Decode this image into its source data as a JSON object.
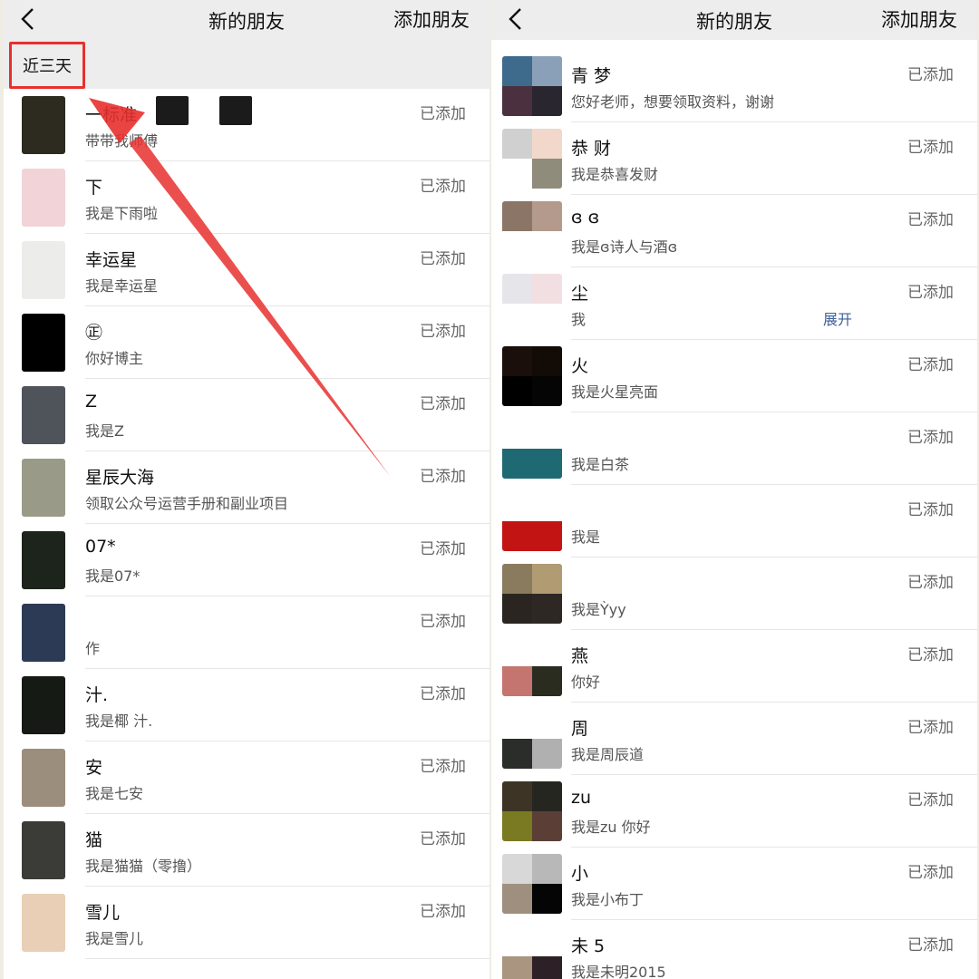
{
  "left": {
    "header": {
      "title": "新的朋友",
      "action": "添加朋友"
    },
    "section_label": "近三天",
    "rows": [
      {
        "name": "一标准",
        "msg": "带带我师傅",
        "status": "已添加"
      },
      {
        "name": "下",
        "msg": "我是下雨啦",
        "status": "已添加"
      },
      {
        "name": "幸运星",
        "msg": "我是幸运星",
        "status": "已添加"
      },
      {
        "name": "㊣",
        "msg": "你好博主",
        "status": "已添加"
      },
      {
        "name": "Z",
        "msg": "我是Z",
        "status": "已添加"
      },
      {
        "name": "星辰大海",
        "msg": "领取公众号运营手册和副业项目",
        "status": "已添加"
      },
      {
        "name": "07*",
        "msg": "我是07*",
        "status": "已添加"
      },
      {
        "name": "",
        "msg": "作",
        "status": "已添加"
      },
      {
        "name": "汁.",
        "msg": "我是椰 汁.",
        "status": "已添加"
      },
      {
        "name": "安",
        "msg": "我是七安",
        "status": "已添加"
      },
      {
        "name": "猫",
        "msg": "我是猫猫（零撸）",
        "status": "已添加"
      },
      {
        "name": "雪儿",
        "msg": "我是雪儿",
        "status": "已添加"
      }
    ]
  },
  "right": {
    "header": {
      "title": "新的朋友",
      "action": "添加朋友"
    },
    "expand_label": "展开",
    "rows": [
      {
        "name": "青 梦",
        "msg": "您好老师，想要领取资料，谢谢",
        "status": "已添加"
      },
      {
        "name": "恭 财",
        "msg": "我是恭喜发财",
        "status": "已添加"
      },
      {
        "name": "ɞ ɞ",
        "msg": "我是ɞ诗人与酒ɞ",
        "status": "已添加"
      },
      {
        "name": "尘",
        "msg": "我",
        "status": "已添加"
      },
      {
        "name": "火",
        "msg": "我是火星亮面",
        "status": "已添加"
      },
      {
        "name": "",
        "msg": "我是白茶",
        "status": "已添加"
      },
      {
        "name": "",
        "msg": "我是",
        "status": "已添加"
      },
      {
        "name": "",
        "msg": "我是Ỳyy",
        "status": "已添加"
      },
      {
        "name": "燕",
        "msg": "你好",
        "status": "已添加"
      },
      {
        "name": "周",
        "msg": "我是周辰道",
        "status": "已添加"
      },
      {
        "name": "zu",
        "msg": "我是zu 你好",
        "status": "已添加"
      },
      {
        "name": "小",
        "msg": "我是小布丁",
        "status": "已添加"
      },
      {
        "name": "未 5",
        "msg": "我是未明2015",
        "status": "已添加"
      }
    ]
  },
  "colors": {
    "accent_red": "#e8302e",
    "link_blue": "#3c5f9a",
    "bar_gray": "#ededed"
  },
  "icons": [
    "chevron-left-icon"
  ]
}
